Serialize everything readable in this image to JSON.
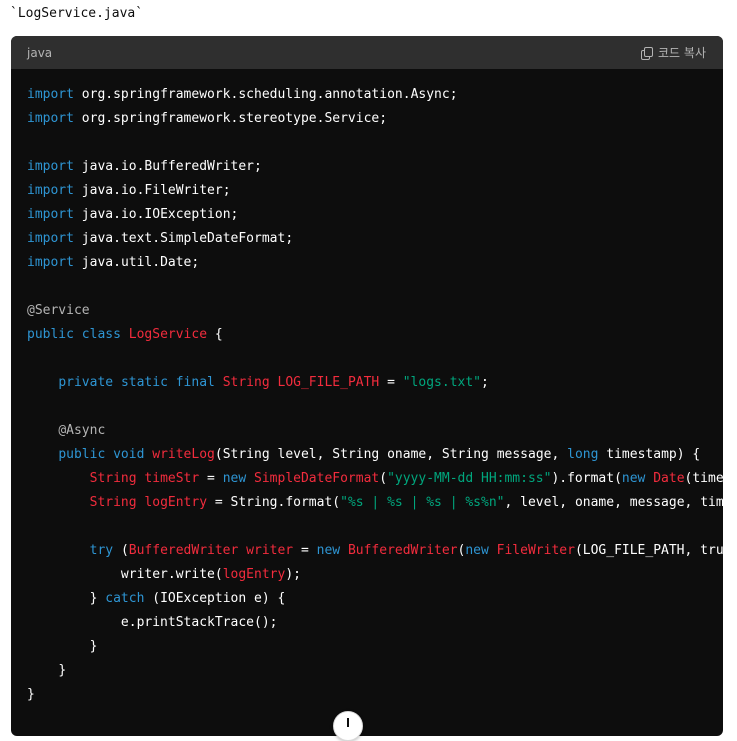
{
  "file_title": "`LogService.java`",
  "code_block": {
    "language": "java",
    "copy_label": "코드 복사",
    "lines": [
      "import org.springframework.scheduling.annotation.Async;",
      "import org.springframework.stereotype.Service;",
      "",
      "import java.io.BufferedWriter;",
      "import java.io.FileWriter;",
      "import java.io.IOException;",
      "import java.text.SimpleDateFormat;",
      "import java.util.Date;",
      "",
      "@Service",
      "public class LogService {",
      "",
      "    private static final String LOG_FILE_PATH = \"logs.txt\";",
      "",
      "    @Async",
      "    public void writeLog(String level, String oname, String message, long timestamp) {",
      "        String timeStr = new SimpleDateFormat(\"yyyy-MM-dd HH:mm:ss\").format(new Date(timest",
      "        String logEntry = String.format(\"%s | %s | %s | %s%n\", level, oname, message, timeS",
      "",
      "        try (BufferedWriter writer = new BufferedWriter(new FileWriter(LOG_FILE_PATH, true",
      "            writer.write(logEntry);",
      "        } catch (IOException e) {",
      "            e.printStackTrace();",
      "        }",
      "    }",
      "}"
    ]
  },
  "scroll_button": {
    "icon": "arrow-down-icon"
  }
}
